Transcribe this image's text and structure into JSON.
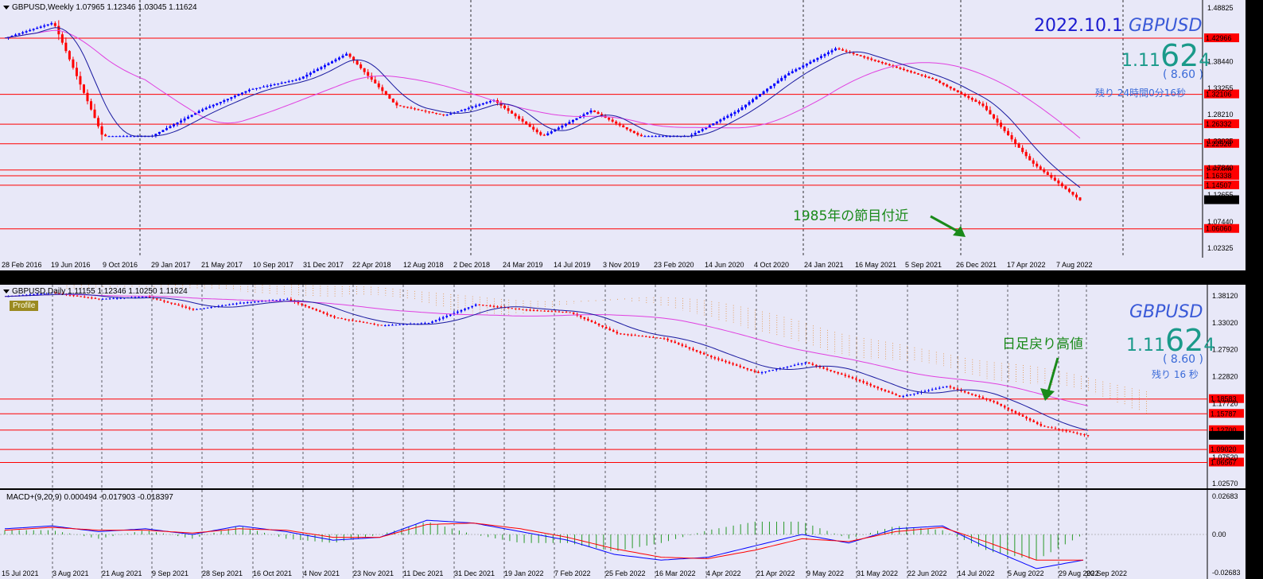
{
  "weekly": {
    "header": "GBPUSD,Weekly  1.07965 1.12346 1.03045 1.11624",
    "date_title": "2022.10.1",
    "symbol": "GBPUSD",
    "price_prefix": "1.11",
    "price_big": "62",
    "price_suffix": "4",
    "change": "( 8.60 )",
    "remaining": "残り 24時間0分16秒",
    "annotation": "1985年の節目付近",
    "x_labels": [
      "28 Feb 2016",
      "19 Jun 2016",
      "9 Oct 2016",
      "29 Jan 2017",
      "21 May 2017",
      "10 Sep 2017",
      "31 Dec 2017",
      "22 Apr 2018",
      "12 Aug 2018",
      "2 Dec 2018",
      "24 Mar 2019",
      "14 Jul 2019",
      "3 Nov 2019",
      "23 Feb 2020",
      "14 Jun 2020",
      "4 Oct 2020",
      "24 Jan 2021",
      "16 May 2021",
      "5 Sep 2021",
      "26 Dec 2021",
      "17 Apr 2022",
      "7 Aug 2022"
    ],
    "y_ticks": [
      "1.48825",
      "1.38440",
      "1.33255",
      "1.28210",
      "1.23025",
      "1.17840",
      "1.12655",
      "1.07440",
      "1.02325"
    ],
    "levels": [
      "1.42966",
      "1.32106",
      "1.26332",
      "1.22528",
      "1.17448",
      "1.16338",
      "1.14507",
      "1.06060"
    ],
    "last_price": "1.11624"
  },
  "daily": {
    "header": "GBPUSD,Daily  1.11155 1.12346 1.10250 1.11624",
    "profile": "Profile",
    "symbol": "GBPUSD",
    "price_prefix": "1.11",
    "price_big": "62",
    "price_suffix": "4",
    "change": "( 8.60 )",
    "remaining": "残り 16 秒",
    "annotation": "日足戻り高値",
    "x_labels": [
      "15 Jul 2021",
      "3 Aug 2021",
      "21 Aug 2021",
      "9 Sep 2021",
      "28 Sep 2021",
      "16 Oct 2021",
      "4 Nov 2021",
      "23 Nov 2021",
      "11 Dec 2021",
      "31 Dec 2021",
      "19 Jan 2022",
      "7 Feb 2022",
      "25 Feb 2022",
      "16 Mar 2022",
      "4 Apr 2022",
      "21 Apr 2022",
      "9 May 2022",
      "31 May 2022",
      "22 Jun 2022",
      "14 Jul 2022",
      "5 Aug 2022",
      "29 Aug 2022",
      "20 Sep 2022"
    ],
    "y_ticks": [
      "1.38120",
      "1.33020",
      "1.27920",
      "1.22820",
      "1.17720",
      "1.07520",
      "1.02570"
    ],
    "levels": [
      "1.18583",
      "1.15787",
      "1.12700",
      "1.09020",
      "1.06567"
    ],
    "last_price": "1.11624"
  },
  "macd": {
    "header": "MACD+(9,20,9) 0.000494 -0.017903 -0.018397",
    "y_ticks": [
      "0.02683",
      "0.00",
      "-0.02683"
    ]
  },
  "colors": {
    "bull": "#0000ff",
    "bear": "#ff0000",
    "level": "#ff0000",
    "ma_long": "#e040e0",
    "ma_short": "#1a1aa0",
    "cloud": "#e08020",
    "annotation": "#1a8a1a"
  },
  "chart_data": [
    {
      "type": "candlestick",
      "title": "GBPUSD,Weekly",
      "ylim": [
        1.02325,
        1.48825
      ],
      "x": [
        "Feb 2016",
        "Jun 2016",
        "Oct 2016",
        "Jan 2017",
        "May 2017",
        "Sep 2017",
        "Dec 2017",
        "Apr 2018",
        "Aug 2018",
        "Dec 2018",
        "Mar 2019",
        "Jul 2019",
        "Nov 2019",
        "Feb 2020",
        "Jun 2020",
        "Oct 2020",
        "Jan 2021",
        "May 2021",
        "Sep 2021",
        "Dec 2021",
        "Apr 2022",
        "Aug 2022",
        "Oct 2022"
      ],
      "close": [
        1.43,
        1.46,
        1.24,
        1.24,
        1.29,
        1.33,
        1.35,
        1.4,
        1.3,
        1.28,
        1.31,
        1.24,
        1.29,
        1.24,
        1.24,
        1.29,
        1.36,
        1.41,
        1.38,
        1.35,
        1.3,
        1.19,
        1.116
      ],
      "ohlc_last": {
        "open": 1.07965,
        "high": 1.12346,
        "low": 1.03045,
        "close": 1.11624
      }
    },
    {
      "type": "candlestick",
      "title": "GBPUSD,Daily",
      "ylim": [
        1.0257,
        1.3812
      ],
      "x": [
        "15 Jul 2021",
        "3 Aug 2021",
        "21 Aug 2021",
        "9 Sep 2021",
        "28 Sep 2021",
        "16 Oct 2021",
        "4 Nov 2021",
        "23 Nov 2021",
        "11 Dec 2021",
        "31 Dec 2021",
        "19 Jan 2022",
        "7 Feb 2022",
        "25 Feb 2022",
        "16 Mar 2022",
        "4 Apr 2022",
        "21 Apr 2022",
        "9 May 2022",
        "31 May 2022",
        "22 Jun 2022",
        "14 Jul 2022",
        "5 Aug 2022",
        "29 Aug 2022",
        "20 Sep 2022",
        "1 Oct 2022"
      ],
      "close": [
        1.38,
        1.387,
        1.375,
        1.38,
        1.355,
        1.368,
        1.375,
        1.34,
        1.325,
        1.33,
        1.365,
        1.355,
        1.35,
        1.31,
        1.3,
        1.265,
        1.235,
        1.255,
        1.225,
        1.19,
        1.21,
        1.18,
        1.135,
        1.116
      ],
      "ohlc_last": {
        "open": 1.11155,
        "high": 1.12346,
        "low": 1.1025,
        "close": 1.11624
      }
    },
    {
      "type": "line",
      "title": "MACD+(9,20,9)",
      "ylim": [
        -0.02683,
        0.02683
      ],
      "series": [
        {
          "name": "MACD",
          "values": [
            0.004,
            0.006,
            0.002,
            0.004,
            0.0,
            0.006,
            0.002,
            -0.004,
            -0.002,
            0.01,
            0.008,
            0.002,
            -0.004,
            -0.014,
            -0.018,
            -0.016,
            -0.008,
            0.0,
            -0.006,
            0.004,
            0.006,
            -0.01,
            -0.024,
            -0.018
          ]
        },
        {
          "name": "Signal",
          "values": [
            0.003,
            0.005,
            0.003,
            0.003,
            0.001,
            0.004,
            0.003,
            -0.002,
            -0.002,
            0.007,
            0.008,
            0.004,
            -0.002,
            -0.01,
            -0.016,
            -0.017,
            -0.011,
            -0.003,
            -0.005,
            0.002,
            0.005,
            -0.006,
            -0.018,
            -0.018
          ]
        }
      ],
      "last": {
        "main": 0.000494,
        "signal": -0.017903,
        "hist": -0.018397
      }
    }
  ]
}
